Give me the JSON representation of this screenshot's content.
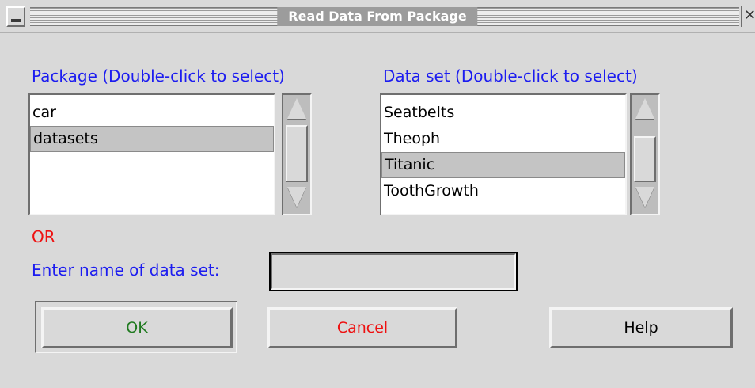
{
  "window": {
    "title": "Read Data From Package"
  },
  "package_list": {
    "label": "Package (Double-click to select)",
    "items": [
      "car",
      "datasets"
    ],
    "selected": "datasets"
  },
  "dataset_list": {
    "label": "Data set (Double-click to select)",
    "items": [
      "Seatbelts",
      "Theoph",
      "Titanic",
      "ToothGrowth"
    ],
    "selected": "Titanic"
  },
  "or_label": "OR",
  "entry": {
    "label": "Enter name of data set:",
    "value": "",
    "placeholder": ""
  },
  "buttons": {
    "ok": "OK",
    "cancel": "Cancel",
    "help": "Help"
  },
  "colors": {
    "label_blue": "#1c1cf0",
    "or_red": "#ee1111",
    "ok_green": "#1f7a1f",
    "cancel_red": "#ee1111"
  }
}
